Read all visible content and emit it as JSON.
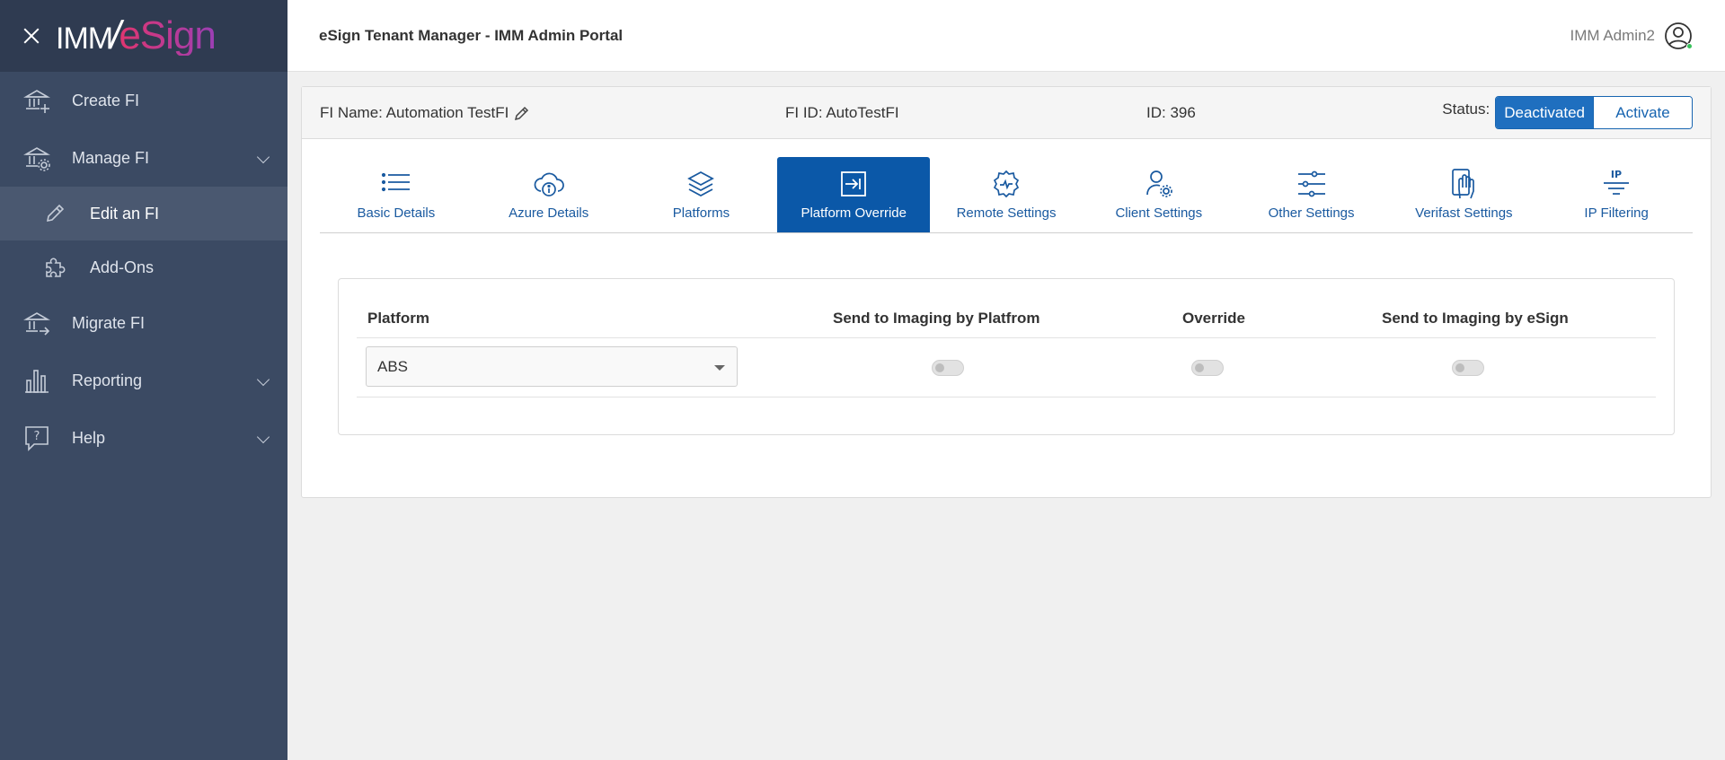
{
  "brand": {
    "imm": "IMM",
    "slash": "/",
    "esign": "eSign"
  },
  "app": {
    "title": "eSign Tenant Manager - IMM Admin Portal"
  },
  "user": {
    "name": "IMM Admin2",
    "status_color": "#37c15a"
  },
  "sidebar": {
    "items": [
      {
        "label": "Create FI",
        "icon": "bank-plus-icon"
      },
      {
        "label": "Manage FI",
        "icon": "bank-gear-icon",
        "expanded": true
      },
      {
        "label": "Edit an FI",
        "icon": "pencil-icon",
        "active": true
      },
      {
        "label": "Add-Ons",
        "icon": "puzzle-icon"
      },
      {
        "label": "Migrate FI",
        "icon": "bank-arrow-icon"
      },
      {
        "label": "Reporting",
        "icon": "bar-chart-icon"
      },
      {
        "label": "Help",
        "icon": "help-bubble-icon"
      }
    ]
  },
  "fi": {
    "name_label": "FI Name: Automation TestFI",
    "id_label": "FI ID: AutoTestFI",
    "num_label": "ID: 396",
    "status_label": "Status:",
    "status_current": "Deactivated",
    "status_action": "Activate"
  },
  "tabs": [
    {
      "label": "Basic Details",
      "icon": "list-icon"
    },
    {
      "label": "Azure Details",
      "icon": "cloud-info-icon"
    },
    {
      "label": "Platforms",
      "icon": "layers-icon"
    },
    {
      "label": "Platform Override",
      "icon": "arrow-into-box-icon",
      "active": true
    },
    {
      "label": "Remote Settings",
      "icon": "gear-signal-icon"
    },
    {
      "label": "Client Settings",
      "icon": "user-gear-icon"
    },
    {
      "label": "Other Settings",
      "icon": "sliders-icon"
    },
    {
      "label": "Verifast Settings",
      "icon": "hand-phone-icon"
    },
    {
      "label": "IP Filtering",
      "icon": "ip-filter-icon",
      "icon_text": "IP"
    }
  ],
  "table": {
    "headers": [
      "Platform",
      "Send to Imaging by Platfrom",
      "Override",
      "Send to Imaging by eSign"
    ],
    "row": {
      "platform": "ABS",
      "send_by_platform": false,
      "override": false,
      "send_by_esign": false
    }
  },
  "colors": {
    "sidebar": "#3b4a63",
    "accent": "#0b58a8",
    "brand_pink": "#c43a8c"
  }
}
